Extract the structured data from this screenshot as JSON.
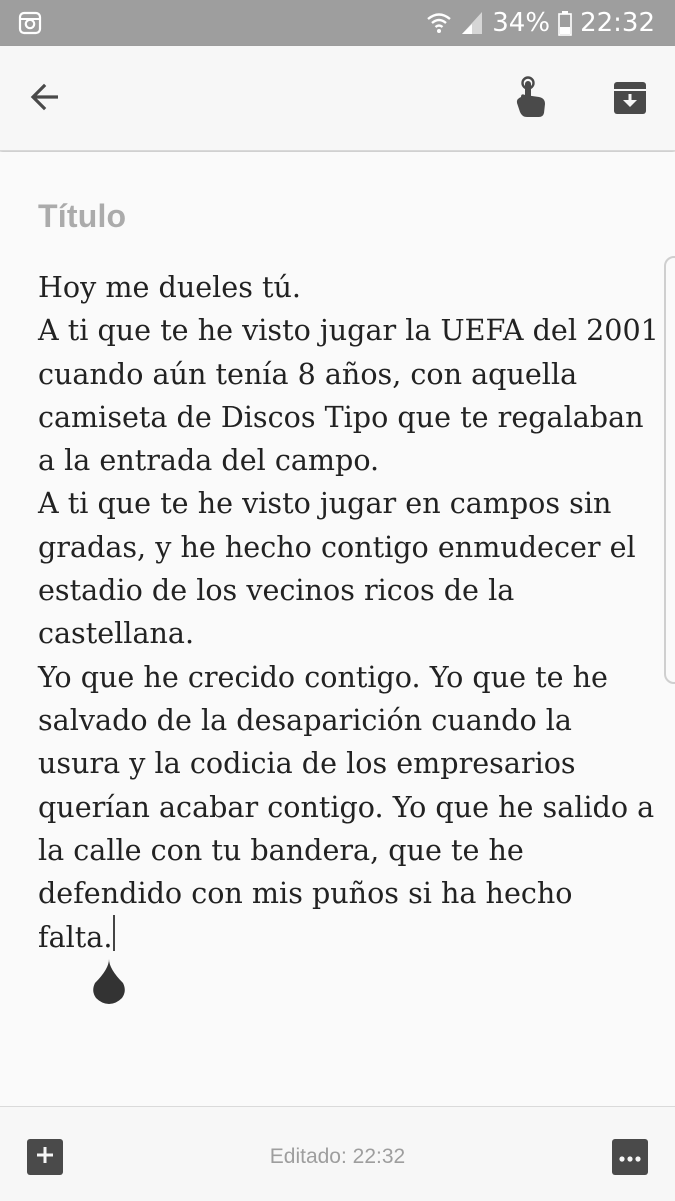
{
  "status_bar": {
    "battery": "34%",
    "time": "22:32",
    "icons": [
      "instagram-icon",
      "wifi-icon",
      "signal-icon",
      "battery-icon"
    ]
  },
  "app_bar": {
    "icons": [
      "back-arrow-icon",
      "reminder-hand-icon",
      "archive-icon"
    ]
  },
  "note": {
    "title_placeholder": "Título",
    "body_lines": [
      "Hoy me dueles tú.",
      "A ti que te he visto jugar la UEFA del 2001",
      "cuando aún tenía 8 años, con aquella",
      "camiseta de Discos Tipo que te regalaban",
      "a la entrada del campo.",
      "A ti que te he visto jugar en campos sin",
      "gradas, y he hecho contigo enmudecer el",
      "estadio de los vecinos ricos de la",
      "castellana.",
      "Yo que he crecido contigo. Yo que te he",
      "salvado de la desaparición cuando la",
      "usura y la codicia de los empresarios",
      "querían acabar contigo. Yo que he salido a",
      "la calle con tu bandera, que te he",
      "defendido con mis puños si ha hecho",
      "falta."
    ]
  },
  "bottom_bar": {
    "edited_label": "Editado: 22:32",
    "icons": [
      "add-box-icon",
      "more-options-icon"
    ]
  },
  "colors": {
    "status_bar": "#9e9e9e",
    "app_bar": "#f7f7f7",
    "text": "#222222",
    "placeholder": "#ababab",
    "icon": "#4a4a4a"
  }
}
